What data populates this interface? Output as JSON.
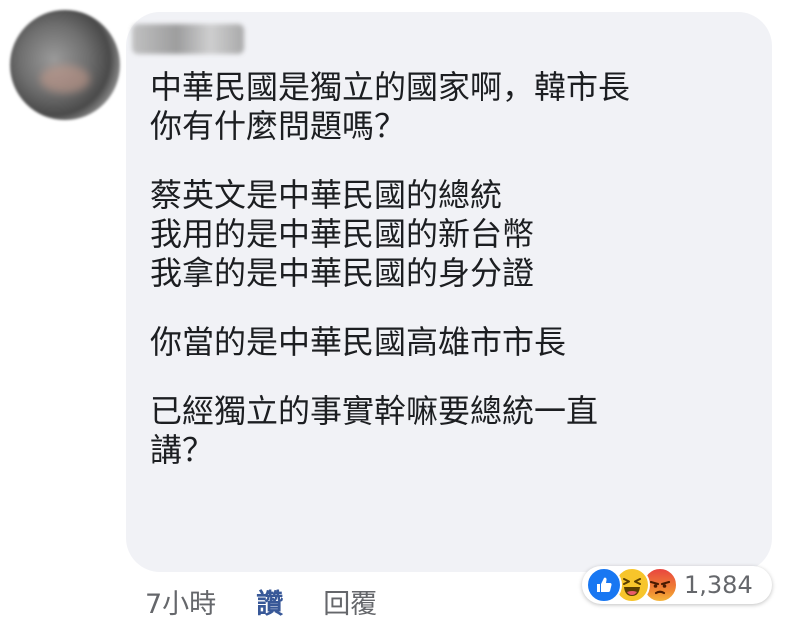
{
  "comment": {
    "author_name": "",
    "lines": [
      "中華民國是獨立的國家啊，韓市長",
      "你有什麼問題嗎？",
      "",
      "蔡英文是中華民國的總統",
      "我用的是中華民國的新台幣",
      "我拿的是中華民國的身分證",
      "",
      "你當的是中華民國高雄市市長",
      "",
      "已經獨立的事實幹嘛要總統一直",
      "講？"
    ]
  },
  "actions": {
    "time": "7小時",
    "like_label": "讚",
    "reply_label": "回覆"
  },
  "reactions": {
    "icons": [
      "like-icon",
      "haha-icon",
      "angry-icon"
    ],
    "count": "1,384"
  },
  "colors": {
    "bubble": "#f1f2f6",
    "link": "#385898",
    "meta": "#65676b",
    "like_blue": "#1877f2",
    "haha_yellow": "#f7c52b",
    "angry_red": "#e9710f"
  }
}
